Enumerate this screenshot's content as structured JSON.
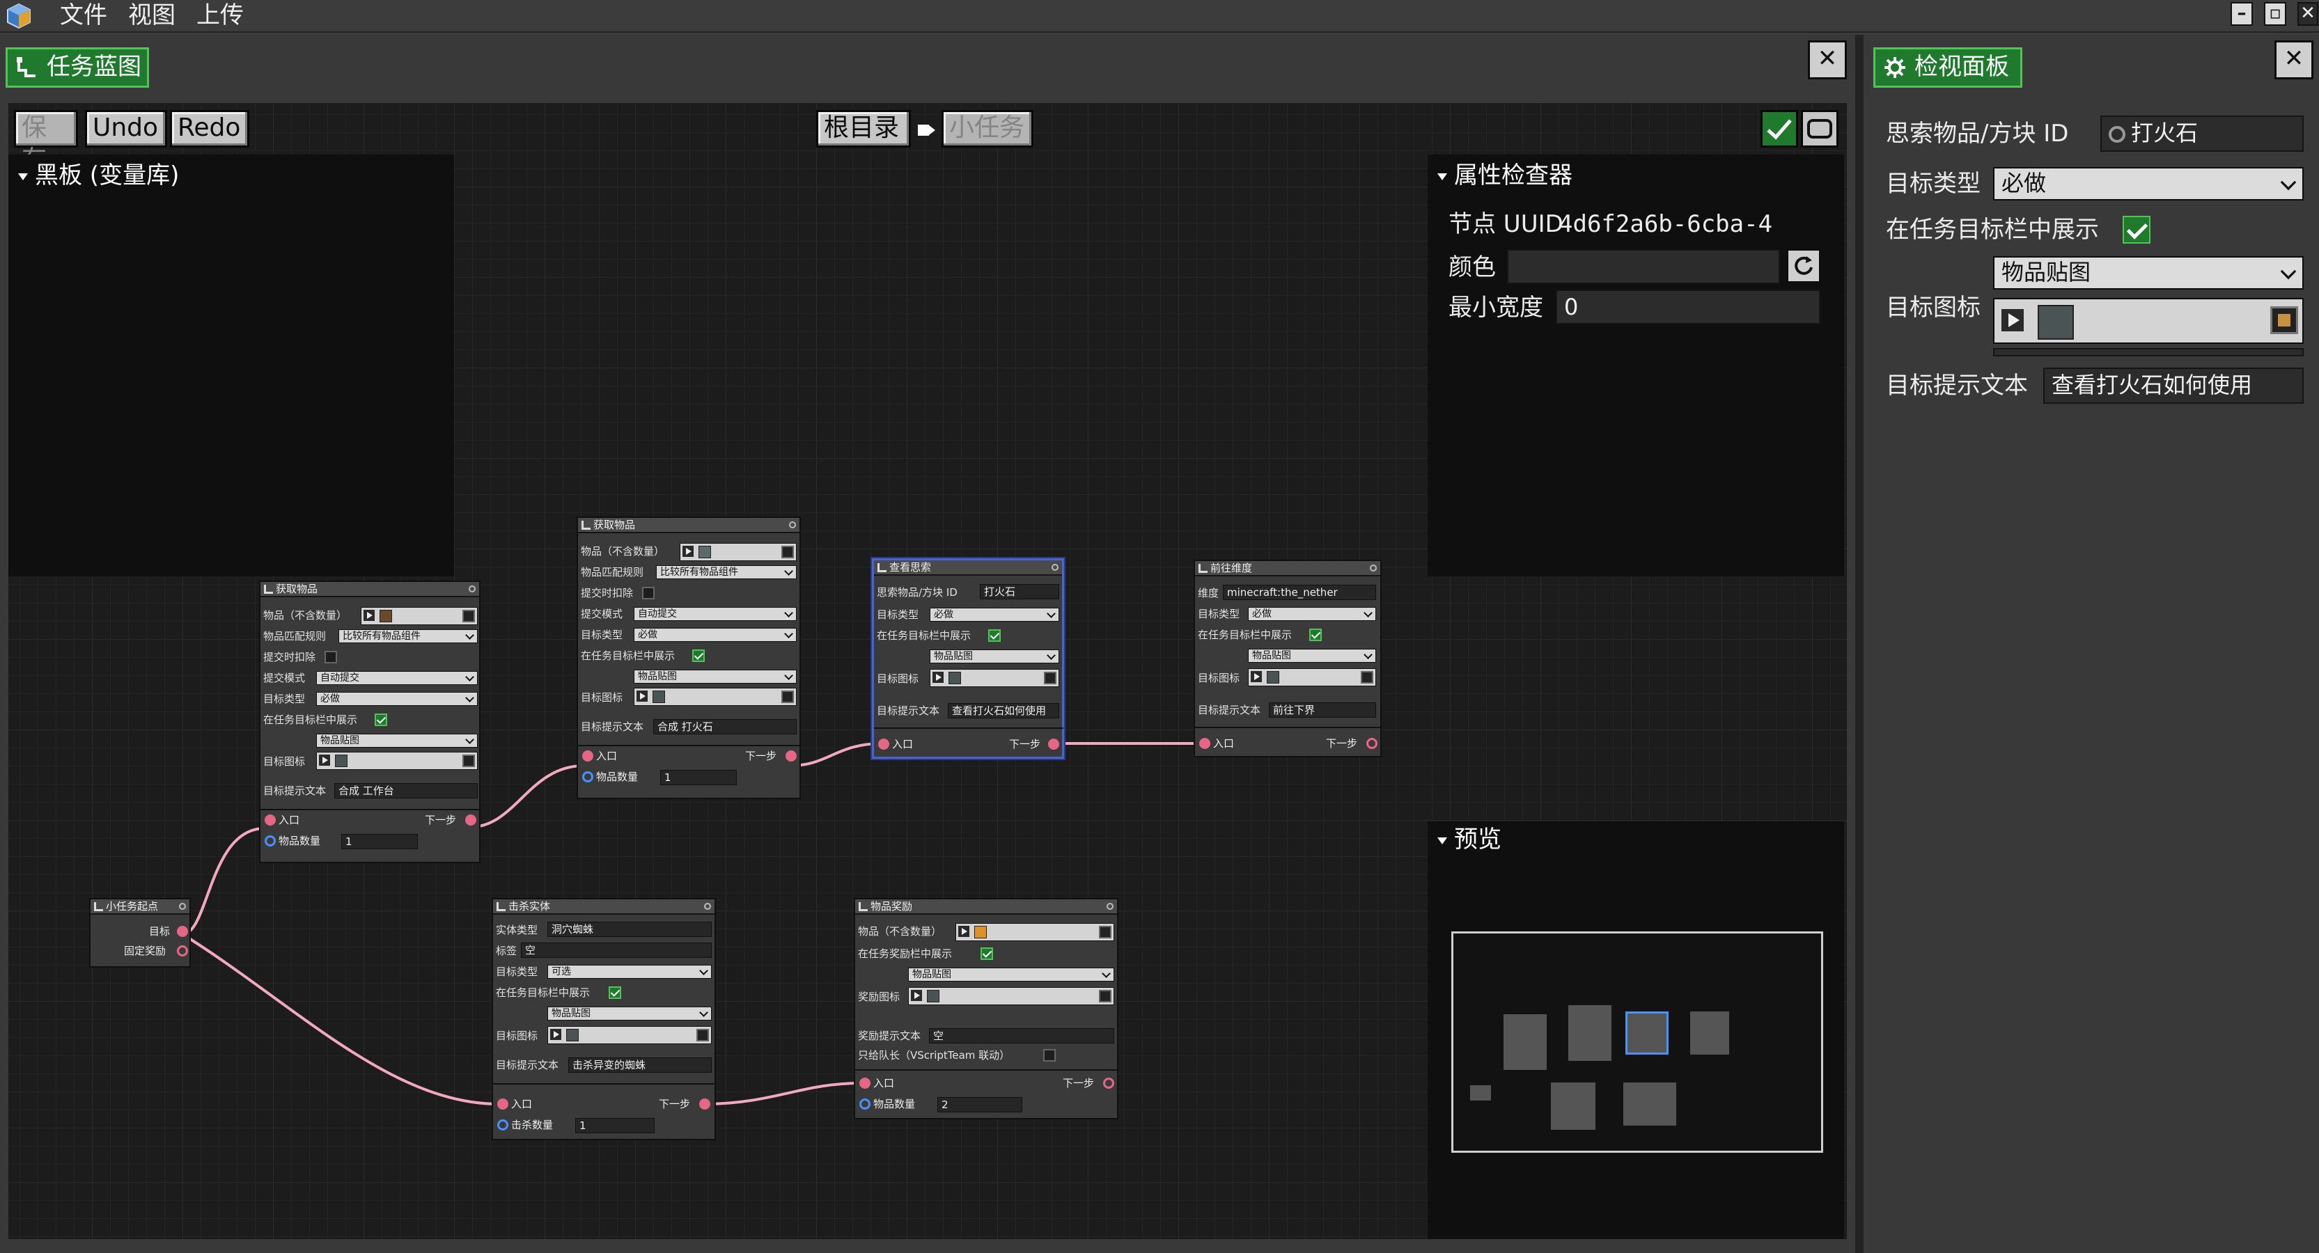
{
  "menubar": {
    "items": [
      "文件",
      "视图",
      "上传"
    ],
    "window_buttons": [
      "–",
      "▫",
      "✕"
    ]
  },
  "left_tab": {
    "title": "任务蓝图",
    "close": "✕"
  },
  "right_tab": {
    "title": "检视面板",
    "close": "✕"
  },
  "toolbar": {
    "save": "保存",
    "undo": "Undo",
    "redo": "Redo",
    "breadcrumb_root": "根目录",
    "breadcrumb_current": "小任务"
  },
  "blackboard": {
    "title": "黑板 (变量库)"
  },
  "inspector": {
    "title": "属性检查器",
    "uuid_label": "节点 UUID",
    "uuid_value": "4d6f2a6b-6cba-4",
    "color_label": "颜色",
    "color_value": "",
    "minwidth_label": "最小宽度",
    "minwidth_value": "0"
  },
  "preview": {
    "title": "预览"
  },
  "right_panel": {
    "item_id_label": "思索物品/方块 ID",
    "item_id_value": "打火石",
    "goal_type_label": "目标类型",
    "goal_type_value": "必做",
    "show_in_bar_label": "在任务目标栏中展示",
    "show_in_bar": true,
    "icon_mode_value": "物品贴图",
    "goal_icon_label": "目标图标",
    "hint_label": "目标提示文本",
    "hint_value": "查看打火石如何使用"
  },
  "nodes": {
    "start": {
      "title": "小任务起点",
      "goal": "目标",
      "fixed_reward": "固定奖励"
    },
    "get1": {
      "title": "获取物品",
      "item_label": "物品（不含数量）",
      "match_label": "物品匹配规则",
      "match_value": "比较所有物品组件",
      "deduct_label": "提交时扣除",
      "submit_label": "提交模式",
      "submit_value": "自动提交",
      "type_label": "目标类型",
      "type_value": "必做",
      "show_label": "在任务目标栏中展示",
      "icon_mode": "物品贴图",
      "icon_label": "目标图标",
      "hint_label": "目标提示文本",
      "hint_value": "合成 工作台",
      "in": "入口",
      "next": "下一步",
      "count_label": "物品数量",
      "count_value": "1"
    },
    "get2": {
      "title": "获取物品",
      "item_label": "物品（不含数量）",
      "match_label": "物品匹配规则",
      "match_value": "比较所有物品组件",
      "deduct_label": "提交时扣除",
      "submit_label": "提交模式",
      "submit_value": "自动提交",
      "type_label": "目标类型",
      "type_value": "必做",
      "show_label": "在任务目标栏中展示",
      "icon_mode": "物品贴图",
      "icon_label": "目标图标",
      "hint_label": "目标提示文本",
      "hint_value": "合成 打火石",
      "in": "入口",
      "next": "下一步",
      "count_label": "物品数量",
      "count_value": "1"
    },
    "ponder": {
      "title": "查看思索",
      "id_label": "思索物品/方块 ID",
      "id_value": "打火石",
      "type_label": "目标类型",
      "type_value": "必做",
      "show_label": "在任务目标栏中展示",
      "icon_mode": "物品贴图",
      "icon_label": "目标图标",
      "hint_label": "目标提示文本",
      "hint_value": "查看打火石如何使用",
      "in": "入口",
      "next": "下一步"
    },
    "dim": {
      "title": "前往维度",
      "dim_label": "维度",
      "dim_value": "minecraft:the_nether",
      "type_label": "目标类型",
      "type_value": "必做",
      "show_label": "在任务目标栏中展示",
      "icon_mode": "物品贴图",
      "icon_label": "目标图标",
      "hint_label": "目标提示文本",
      "hint_value": "前往下界",
      "in": "入口",
      "next": "下一步"
    },
    "kill": {
      "title": "击杀实体",
      "entity_label": "实体类型",
      "entity_value": "洞穴蜘蛛",
      "tag_label": "标签",
      "tag_value": "空",
      "type_label": "目标类型",
      "type_value": "可选",
      "show_label": "在任务目标栏中展示",
      "icon_mode": "物品贴图",
      "icon_label": "目标图标",
      "hint_label": "目标提示文本",
      "hint_value": "击杀异变的蜘蛛",
      "in": "入口",
      "next": "下一步",
      "count_label": "击杀数量",
      "count_value": "1"
    },
    "reward": {
      "title": "物品奖励",
      "item_label": "物品（不含数量）",
      "show_label": "在任务奖励栏中展示",
      "icon_mode": "物品贴图",
      "icon_label": "奖励图标",
      "hint_label": "奖励提示文本",
      "hint_value": "空",
      "leader_label": "只给队长（VScriptTeam 联动）",
      "in": "入口",
      "next": "下一步",
      "count_label": "物品数量",
      "count_value": "2"
    }
  }
}
